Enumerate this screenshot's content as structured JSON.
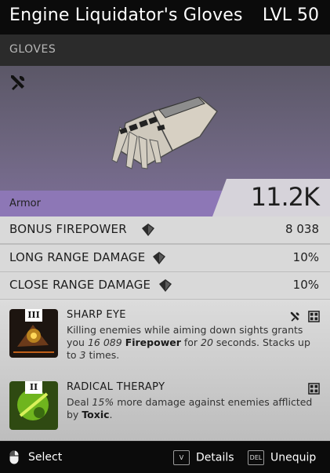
{
  "item": {
    "name": "Engine Liquidator's Gloves",
    "level": "LVL 50",
    "type": "GLOVES"
  },
  "hero": {
    "mod_icon": "wrench-screwdriver-icon",
    "image": "glove-image"
  },
  "armor": {
    "label": "Armor",
    "value": "11.2K"
  },
  "stats": [
    {
      "label": "BONUS FIREPOWER",
      "value": "8 038",
      "icon": "shield-gem-icon"
    },
    {
      "label": "LONG RANGE DAMAGE",
      "value": "10%",
      "icon": "shield-gem-icon"
    },
    {
      "label": "CLOSE RANGE DAMAGE",
      "value": "10%",
      "icon": "shield-gem-icon"
    }
  ],
  "mods": [
    {
      "tier": "III",
      "title": "SHARP EYE",
      "desc": {
        "p1": "Killing enemies while aiming down sights grants you ",
        "v1": "16 089",
        "k1": "Firepower",
        "p2": " for ",
        "v2": "20",
        "p3": " seconds. Stacks up to ",
        "v3": "3",
        "p4": " times."
      },
      "icons": [
        "wrench-screwdriver-icon",
        "grid-icon"
      ]
    },
    {
      "tier": "II",
      "title": "RADICAL THERAPY",
      "desc": {
        "p0": "Deal ",
        "v1": "15%",
        "p1": " more damage against enemies afflicted by ",
        "k1": "Toxic",
        "p2": "."
      },
      "icons": [
        "grid-icon"
      ]
    }
  ],
  "footer": {
    "select": {
      "icon": "mouse-icon",
      "label": "Select"
    },
    "details": {
      "key": "V",
      "label": "Details"
    },
    "unequip": {
      "key": "DEL",
      "label": "Unequip"
    }
  },
  "colors": {
    "hero_top": "#5b5767",
    "armor_band": "#8d77b6",
    "stat_bg": "#d9d9d9",
    "bar_bg": "#0b0b0b"
  }
}
